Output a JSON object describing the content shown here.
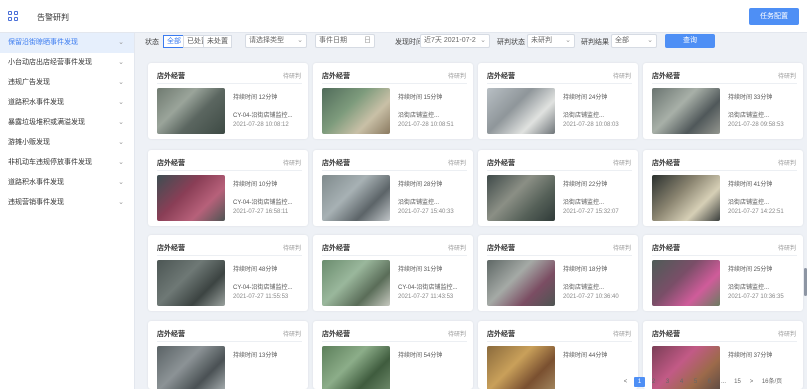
{
  "app": {
    "title": "告警研判",
    "top_button": "任务配置"
  },
  "sidebar": {
    "items": [
      {
        "label": "保留沿街晾晒事件发现",
        "active": true
      },
      {
        "label": "小台动店出店经营事件发现",
        "active": false
      },
      {
        "label": "违规广告发现",
        "active": false
      },
      {
        "label": "道路积水事件发现",
        "active": false
      },
      {
        "label": "暴露垃圾堆积或满溢发现",
        "active": false
      },
      {
        "label": "游摊小贩发现",
        "active": false
      },
      {
        "label": "非机动车违规停放事件发现",
        "active": false
      },
      {
        "label": "道路积水事件发现",
        "active": false
      },
      {
        "label": "违规营销事件发现",
        "active": false
      }
    ]
  },
  "filters": {
    "label_status": "状态",
    "seg_all": "全部",
    "seg_done": "已处置",
    "seg_pending": "未处置",
    "select_type": "请选择类型",
    "select_range": "事件日期",
    "select_range_end": "日",
    "label_time": "发现时间",
    "select_time": "近7天 2021-07-2",
    "label_source": "研判状态",
    "select_source": "未研判",
    "label_result": "研判结果",
    "select_result": "全部",
    "search_button": "查询"
  },
  "cards": [
    {
      "type": "店外经营",
      "status": "待研判",
      "time": "持续时间 12分钟",
      "camera": "CY-04-沿街店铺监控...",
      "date": "2021-07-28 10:08:12"
    },
    {
      "type": "店外经营",
      "status": "待研判",
      "time": "持续时间 15分钟",
      "camera": "沿街店铺监控...",
      "date": "2021-07-28 10:08:51"
    },
    {
      "type": "店外经营",
      "status": "待研判",
      "time": "持续时间 24分钟",
      "camera": "沿街店铺监控...",
      "date": "2021-07-28 10:08:03"
    },
    {
      "type": "店外经营",
      "status": "待研判",
      "time": "持续时间 33分钟",
      "camera": "沿街店铺监控...",
      "date": "2021-07-28 09:58:53"
    },
    {
      "type": "店外经营",
      "status": "待研判",
      "time": "持续时间 10分钟",
      "camera": "CY-04-沿街店铺监控...",
      "date": "2021-07-27 16:58:11"
    },
    {
      "type": "店外经营",
      "status": "待研判",
      "time": "持续时间 28分钟",
      "camera": "沿街店铺监控...",
      "date": "2021-07-27 15:40:33"
    },
    {
      "type": "店外经营",
      "status": "待研判",
      "time": "持续时间 22分钟",
      "camera": "沿街店铺监控...",
      "date": "2021-07-27 15:32:07"
    },
    {
      "type": "店外经营",
      "status": "待研判",
      "time": "持续时间 41分钟",
      "camera": "沿街店铺监控...",
      "date": "2021-07-27 14:22:51"
    },
    {
      "type": "店外经营",
      "status": "待研判",
      "time": "持续时间 48分钟",
      "camera": "CY-04-沿街店铺监控...",
      "date": "2021-07-27 11:55:53"
    },
    {
      "type": "店外经营",
      "status": "待研判",
      "time": "持续时间 31分钟",
      "camera": "CY-04-沿街店铺监控...",
      "date": "2021-07-27 11:43:53"
    },
    {
      "type": "店外经营",
      "status": "待研判",
      "time": "持续时间 18分钟",
      "camera": "沿街店铺监控...",
      "date": "2021-07-27 10:36:40"
    },
    {
      "type": "店外经营",
      "status": "待研判",
      "time": "持续时间 25分钟",
      "camera": "沿街店铺监控...",
      "date": "2021-07-27 10:36:35"
    },
    {
      "type": "店外经营",
      "status": "待研判",
      "time": "持续时间 13分钟",
      "camera": "",
      "date": ""
    },
    {
      "type": "店外经营",
      "status": "待研判",
      "time": "持续时间 54分钟",
      "camera": "",
      "date": ""
    },
    {
      "type": "店外经营",
      "status": "待研判",
      "time": "持续时间 44分钟",
      "camera": "",
      "date": ""
    },
    {
      "type": "店外经营",
      "status": "待研判",
      "time": "持续时间 37分钟",
      "camera": "",
      "date": ""
    }
  ],
  "pagination": {
    "prev": "<",
    "pages": [
      "1",
      "2",
      "3",
      "4",
      "5",
      "6"
    ],
    "ellipsis": "...",
    "last": "15",
    "next": ">",
    "size": "16条/页"
  }
}
